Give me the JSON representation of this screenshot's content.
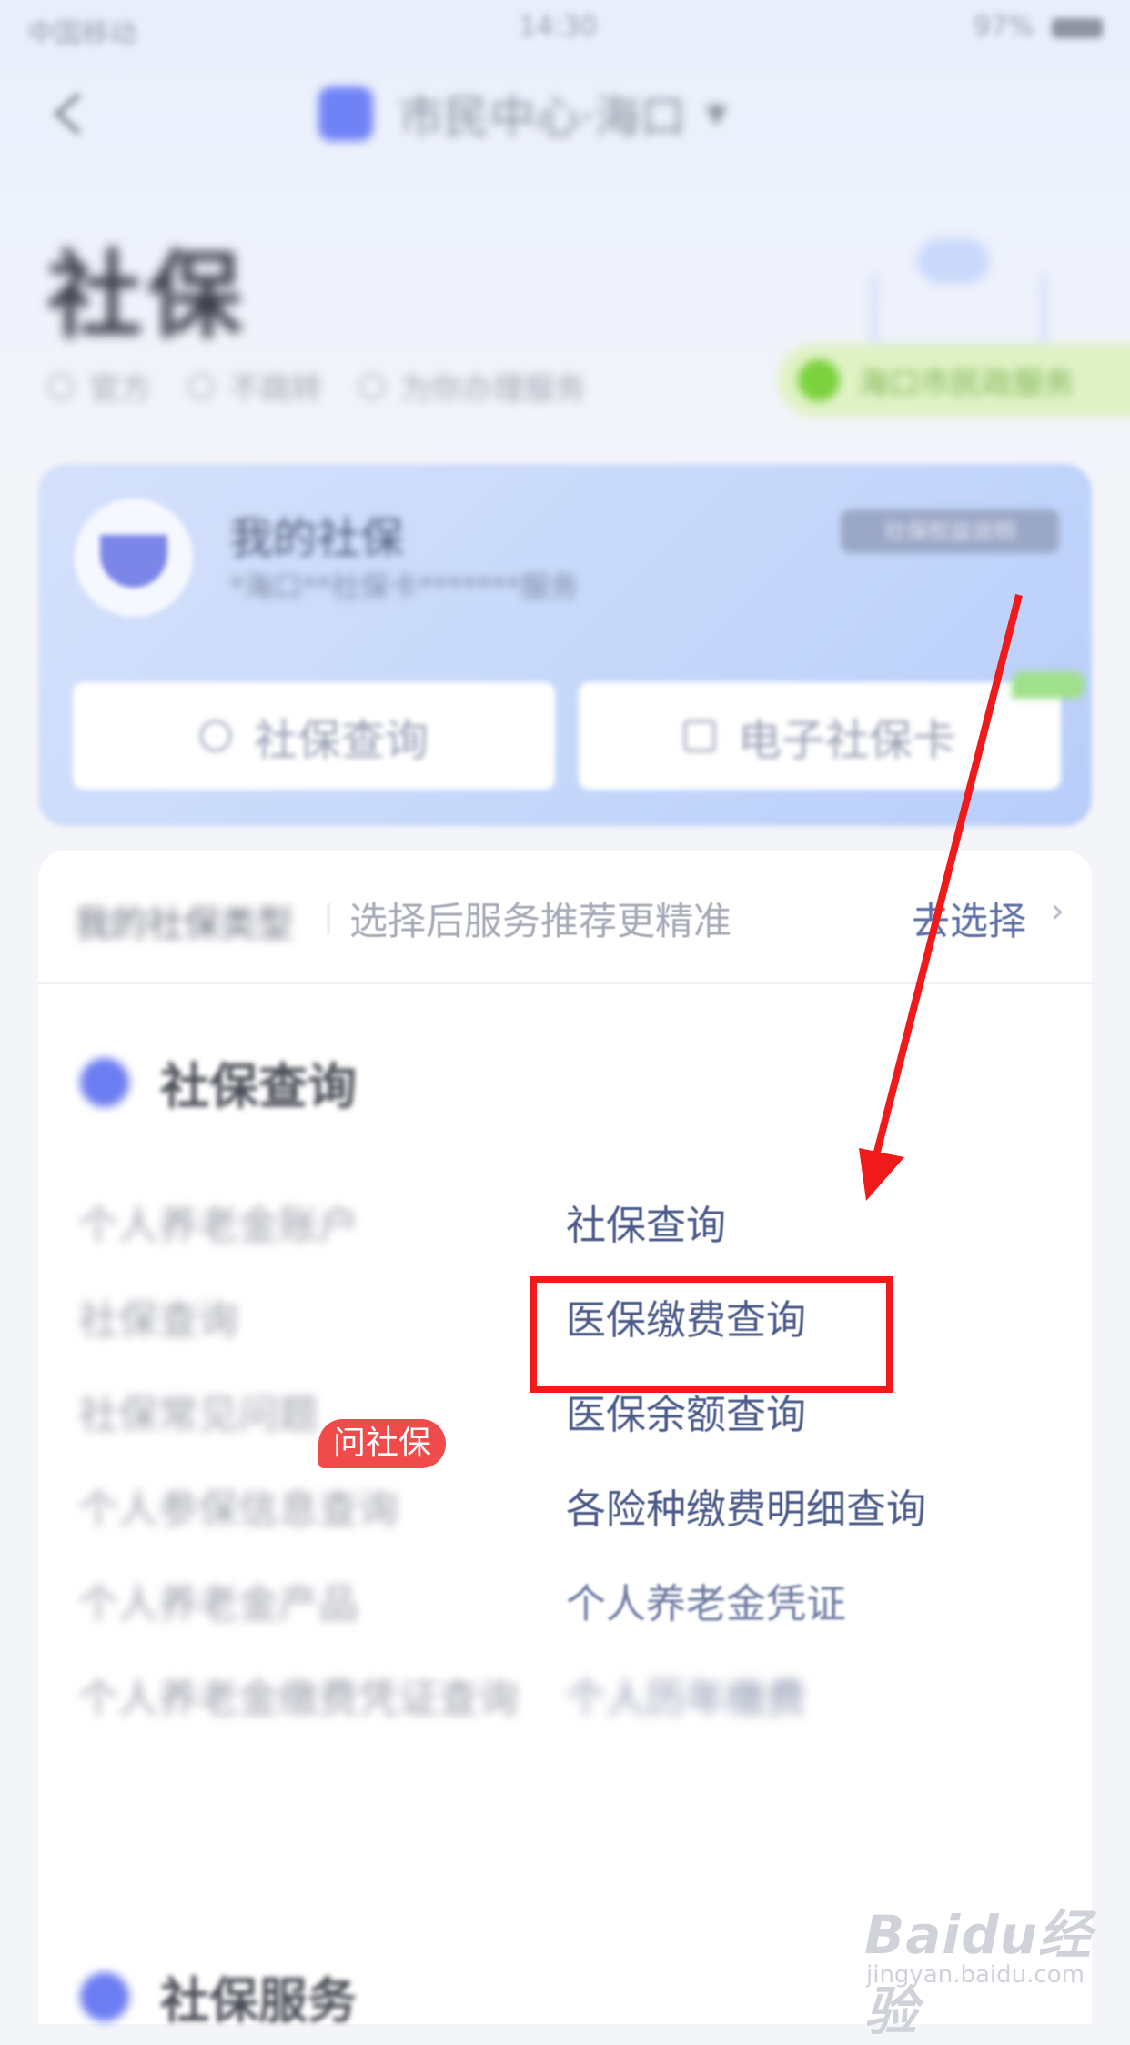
{
  "status_bar": {
    "carrier": "中国移动",
    "time": "14:30",
    "battery": "97%"
  },
  "nav": {
    "title": "市民中心·海口"
  },
  "page": {
    "title": "社保"
  },
  "tags": [
    "官方",
    "不跳转",
    "为你办理服务"
  ],
  "promo": {
    "text": "海口市民政服务"
  },
  "card": {
    "title": "我的社保",
    "subtitle": "*海口**社保卡*******服务",
    "badge": "社保权益说明",
    "btn_query": "社保查询",
    "btn_ecard": "电子社保卡"
  },
  "type_row": {
    "label": "我的社保类型",
    "hint": "选择后服务推荐更精准",
    "link": "去选择"
  },
  "section1": {
    "title": "社保查询"
  },
  "left_items": [
    "个人养老金账户",
    "社保查询",
    "社保常见问题",
    "个人参保信息查询",
    "个人养老金产品",
    "个人养老金缴费凭证查询"
  ],
  "right_items": [
    "社保查询",
    "医保缴费查询",
    "医保余额查询",
    "各险种缴费明细查询",
    "个人养老金凭证",
    "个人历年缴费"
  ],
  "badge": "问社保",
  "section2": {
    "title": "社保服务"
  },
  "watermark": {
    "main": "Baidu经验",
    "sub": "jingyan.baidu.com"
  },
  "colors": {
    "accent": "#4c5b8a",
    "highlight": "#f01a1a",
    "badge": "#ef4b4b",
    "link": "#5d6fa5"
  }
}
